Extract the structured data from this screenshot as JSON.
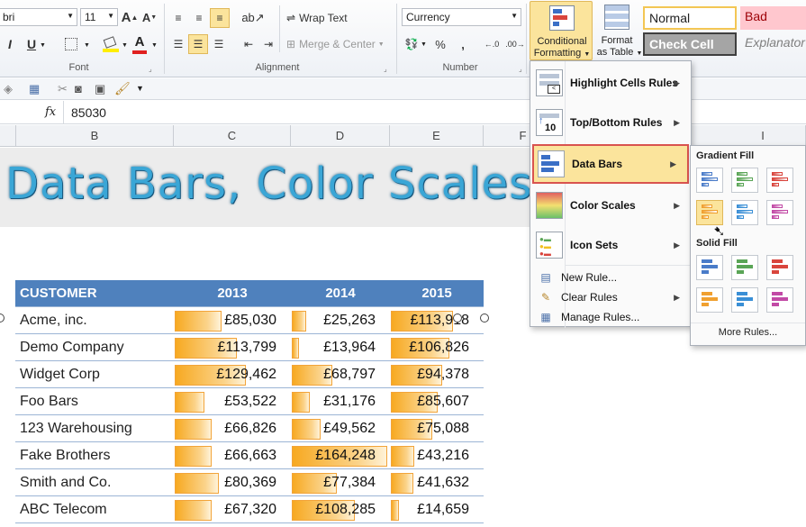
{
  "ribbon": {
    "font_name": "bri",
    "font_size": "11",
    "number_format": "Currency",
    "wrap_text": "Wrap Text",
    "merge_center": "Merge & Center",
    "percent": "%",
    "comma": ",",
    "groups": {
      "font": "Font",
      "alignment": "Alignment",
      "number": "Number"
    },
    "conditional_formatting": {
      "line1": "Conditional",
      "line2": "Formatting"
    },
    "format_as_table": {
      "line1": "Format",
      "line2": "as Table"
    },
    "styles": {
      "normal": "Normal",
      "bad": "Bad",
      "check_cell": "Check Cell",
      "explanatory": "Explanator"
    },
    "italic": "I",
    "underline": "U",
    "font_color": "A"
  },
  "formula_bar": {
    "fx": "fx",
    "value": "85030"
  },
  "columns": [
    "B",
    "C",
    "D",
    "E",
    "F",
    "I"
  ],
  "banner_title": "Data Bars, Color Scales & I",
  "table": {
    "headers": [
      "CUSTOMER",
      "2013",
      "2014",
      "2015"
    ],
    "rows": [
      {
        "customer": "Acme, inc.",
        "v2013": "£85,030",
        "v2014": "£25,263",
        "v2015": "£113,918",
        "f2013": 0.52,
        "f2014": 0.15,
        "f2015": 0.69
      },
      {
        "customer": "Demo Company",
        "v2013": "£113,799",
        "v2014": "£13,964",
        "v2015": "£106,826",
        "f2013": 0.69,
        "f2014": 0.08,
        "f2015": 0.65
      },
      {
        "customer": "Widget Corp",
        "v2013": "£129,462",
        "v2014": "£68,797",
        "v2015": "£94,378",
        "f2013": 0.79,
        "f2014": 0.42,
        "f2015": 0.57
      },
      {
        "customer": "Foo Bars",
        "v2013": "£53,522",
        "v2014": "£31,176",
        "v2015": "£85,607",
        "f2013": 0.33,
        "f2014": 0.19,
        "f2015": 0.52
      },
      {
        "customer": "123 Warehousing",
        "v2013": "£66,826",
        "v2014": "£49,562",
        "v2015": "£75,088",
        "f2013": 0.41,
        "f2014": 0.3,
        "f2015": 0.46
      },
      {
        "customer": "Fake Brothers",
        "v2013": "£66,663",
        "v2014": "£164,248",
        "v2015": "£43,216",
        "f2013": 0.41,
        "f2014": 1.0,
        "f2015": 0.26
      },
      {
        "customer": "Smith and Co.",
        "v2013": "£80,369",
        "v2014": "£77,384",
        "v2015": "£41,632",
        "f2013": 0.49,
        "f2014": 0.47,
        "f2015": 0.25
      },
      {
        "customer": "ABC Telecom",
        "v2013": "£67,320",
        "v2014": "£108,285",
        "v2015": "£14,659",
        "f2013": 0.41,
        "f2014": 0.66,
        "f2015": 0.09
      }
    ]
  },
  "cf_menu": {
    "items": [
      "Highlight Cells Rules",
      "Top/Bottom Rules",
      "Data Bars",
      "Color Scales",
      "Icon Sets"
    ],
    "new_rule": "New Rule...",
    "clear_rules": "Clear Rules",
    "manage_rules": "Manage Rules..."
  },
  "databars_submenu": {
    "gradient_fill": "Gradient Fill",
    "solid_fill": "Solid Fill",
    "more_rules": "More Rules...",
    "gradient_colors": [
      "#4a7cc9",
      "#5aa556",
      "#d9453d",
      "#f0a030",
      "#3a8fd6",
      "#c24aa6"
    ],
    "solid_colors": [
      "#4a7cc9",
      "#5aa556",
      "#d9453d",
      "#f0a030",
      "#3a8fd6",
      "#c24aa6"
    ]
  },
  "colors": {
    "accent": "#4f81bd",
    "highlight": "#fbe49c",
    "bar": "#f7a921",
    "selection_border": "#d9534f"
  }
}
